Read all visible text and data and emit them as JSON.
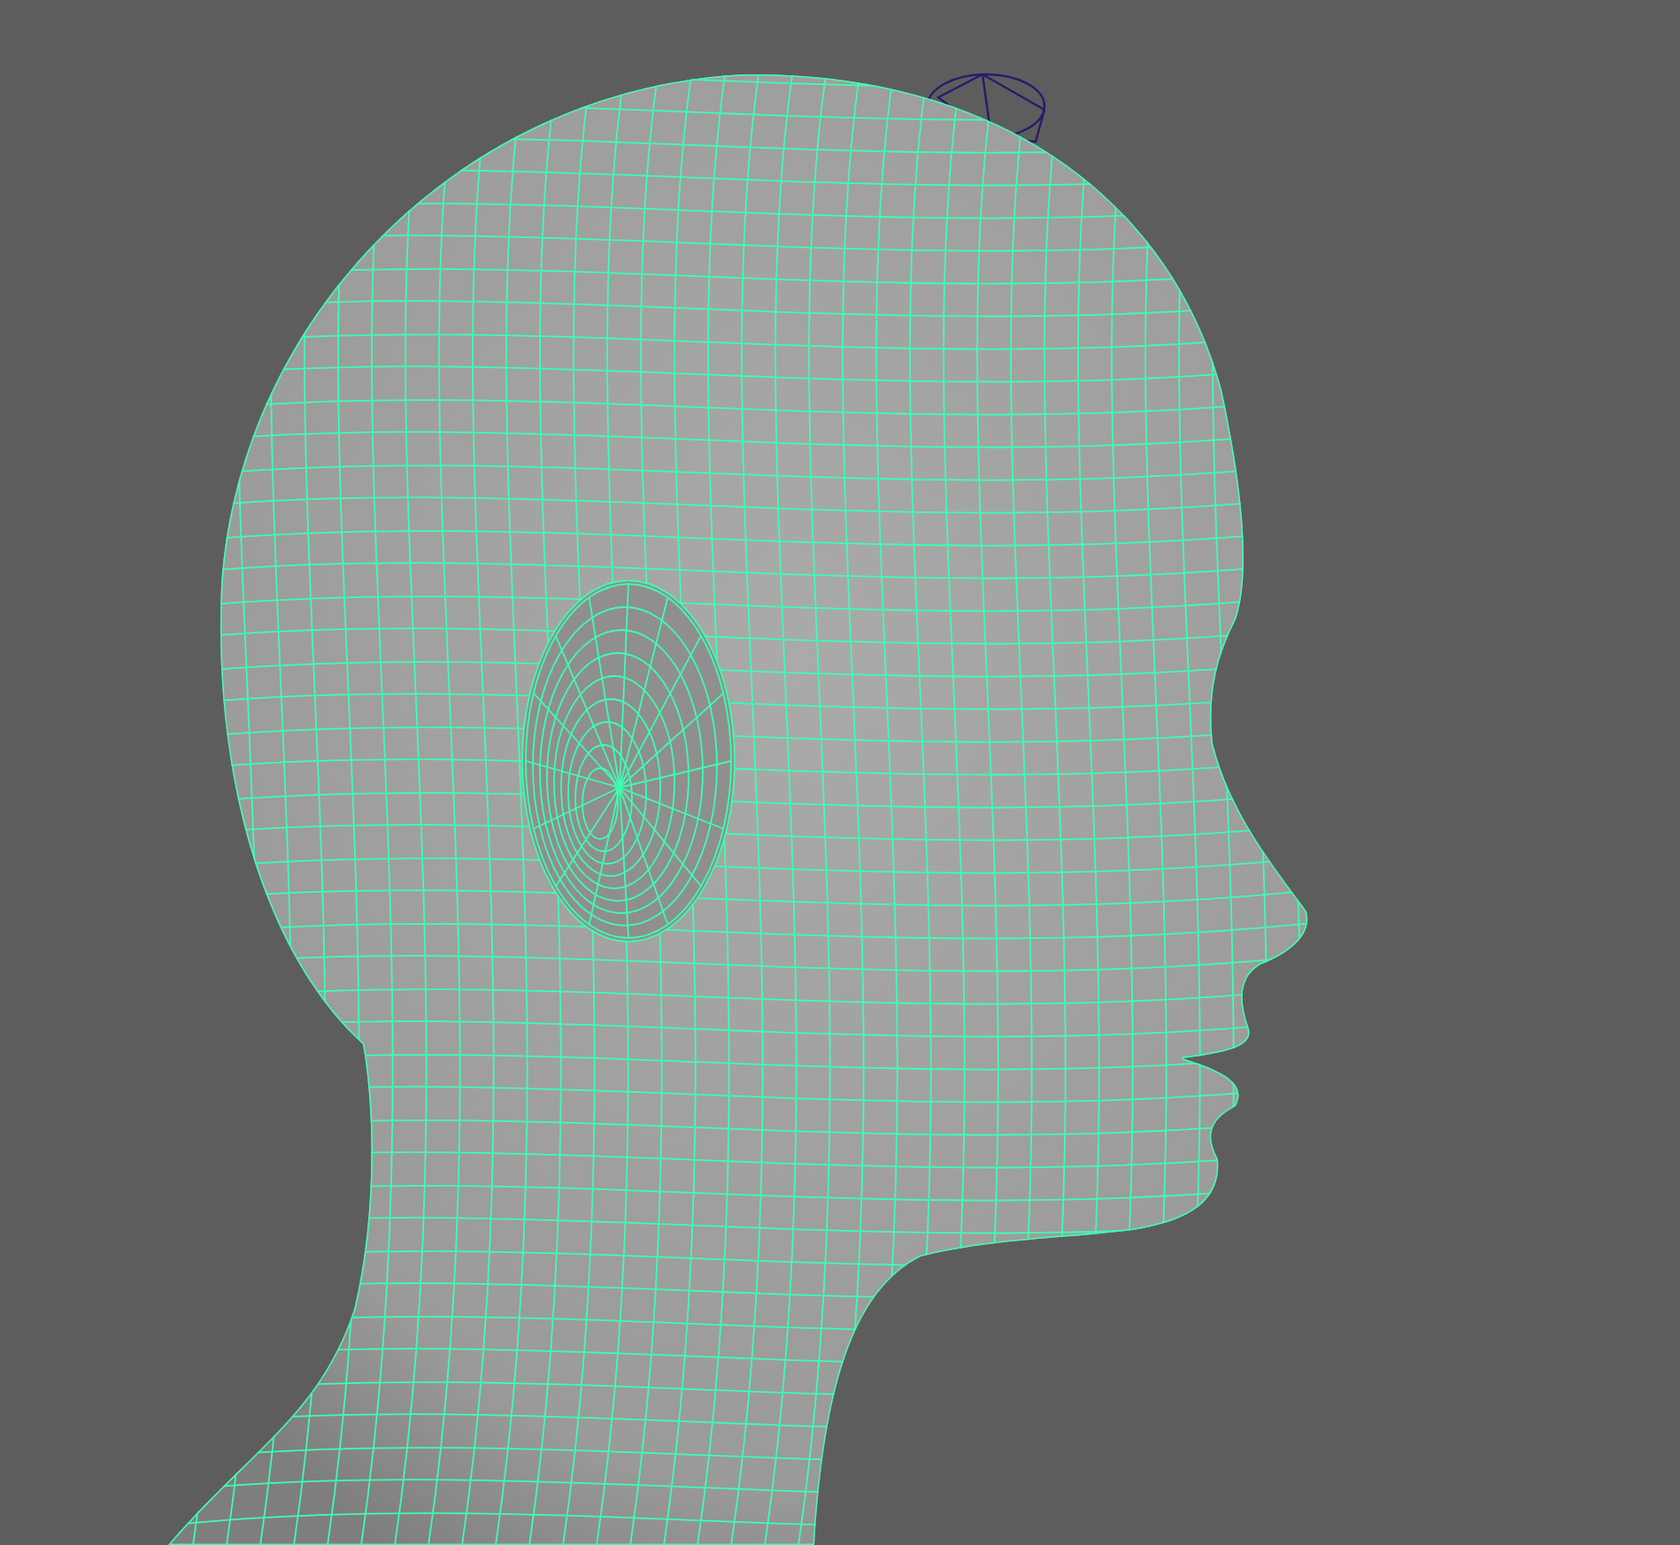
{
  "viewport": {
    "mesh": {
      "selected": true
    }
  }
}
